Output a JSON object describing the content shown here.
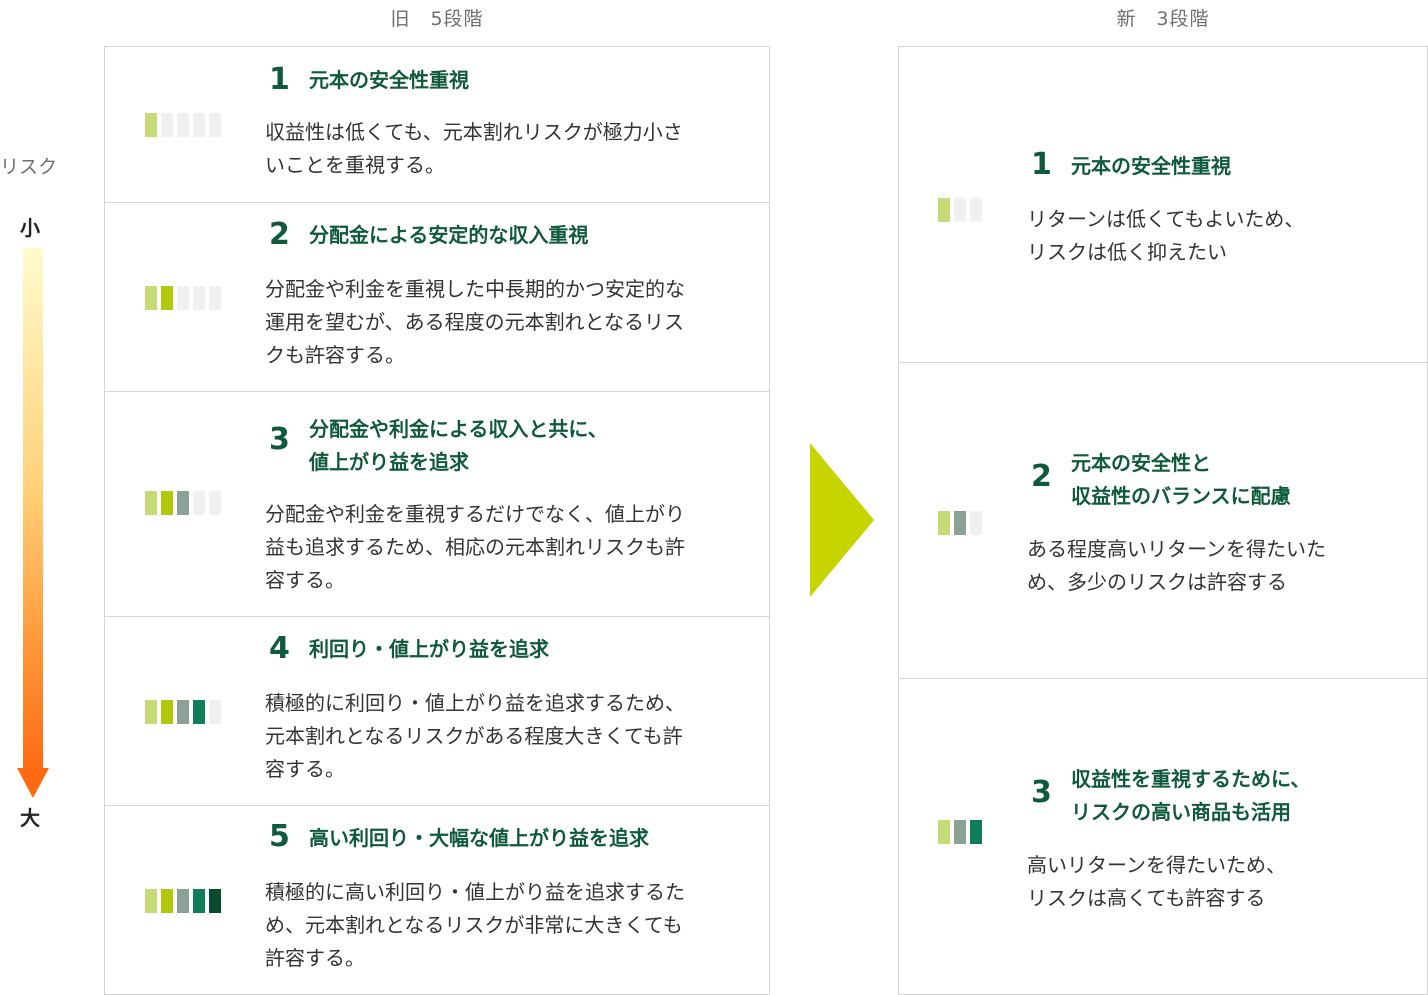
{
  "old_heading": "旧　5段階",
  "new_heading": "新　3段階",
  "risk_scale": {
    "label": "リスク",
    "low": "小",
    "high": "大"
  },
  "palette": [
    "#c5dc76",
    "#b2c80a",
    "#8aa294",
    "#0e7d58",
    "#0a4a30"
  ],
  "old_levels": [
    {
      "num": "1",
      "title": [
        "元本の安全性重視"
      ],
      "desc": [
        "収益性は低くても、元本割れリスクが極力小さ",
        "いことを重視する。"
      ],
      "risk_level": 1
    },
    {
      "num": "2",
      "title": [
        "分配金による安定的な収入重視"
      ],
      "desc": [
        "分配金や利金を重視した中長期的かつ安定的な",
        "運用を望むが、ある程度の元本割れとなるリス",
        "クも許容する。"
      ],
      "risk_level": 2
    },
    {
      "num": "3",
      "title": [
        "分配金や利金による収入と共に、",
        "値上がり益を追求"
      ],
      "desc": [
        "分配金や利金を重視するだけでなく、値上がり",
        "益も追求するため、相応の元本割れリスクも許",
        "容する。"
      ],
      "risk_level": 3
    },
    {
      "num": "4",
      "title": [
        "利回り・値上がり益を追求"
      ],
      "desc": [
        "積極的に利回り・値上がり益を追求するため、",
        "元本割れとなるリスクがある程度大きくても許",
        "容する。"
      ],
      "risk_level": 4
    },
    {
      "num": "5",
      "title": [
        "高い利回り・大幅な値上がり益を追求"
      ],
      "desc": [
        "積極的に高い利回り・値上がり益を追求するた",
        "め、元本割れとなるリスクが非常に大きくても",
        "許容する。"
      ],
      "risk_level": 5
    }
  ],
  "new_levels": [
    {
      "num": "1",
      "title": [
        "元本の安全性重視"
      ],
      "desc": [
        "リターンは低くてもよいため、",
        "リスクは低く抑えたい"
      ],
      "risk_level": 1
    },
    {
      "num": "2",
      "title": [
        "元本の安全性と",
        "収益性のバランスに配慮"
      ],
      "desc": [
        "ある程度高いリターンを得たいた",
        "め、多少のリスクは許容する"
      ],
      "risk_level": 2
    },
    {
      "num": "3",
      "title": [
        "収益性を重視するために、",
        "リスクの高い商品も活用"
      ],
      "desc": [
        "高いリターンを得たいため、",
        "リスクは高くても許容する"
      ],
      "risk_level": 3
    }
  ],
  "new_meter_colors": [
    "#c5dc76",
    "#8aa294",
    "#0e7d58"
  ]
}
